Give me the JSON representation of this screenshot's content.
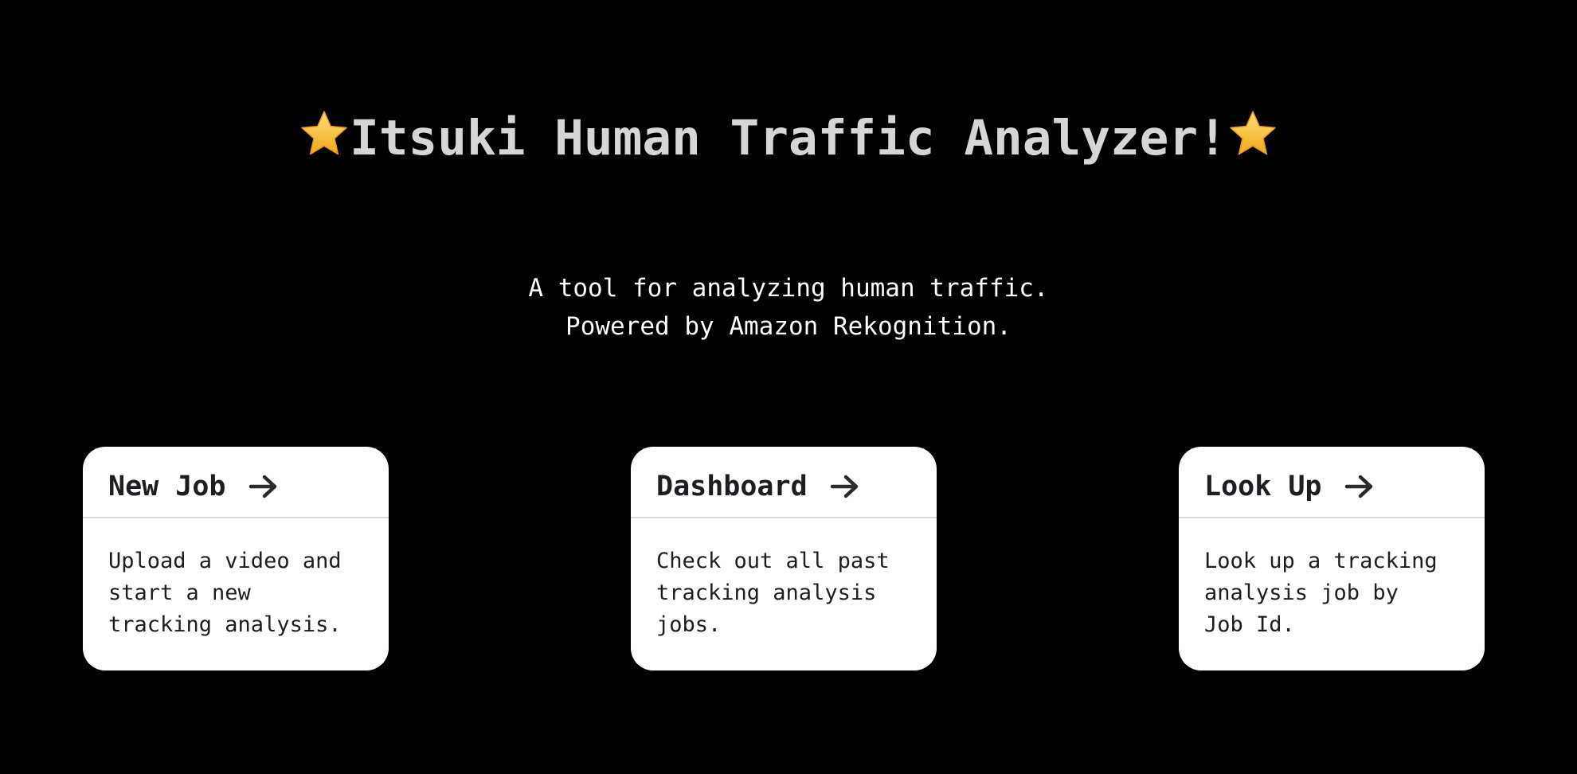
{
  "header": {
    "title": "Itsuki Human Traffic Analyzer!",
    "star_icon": "star-icon",
    "title_color": "#d6d6d6"
  },
  "intro": {
    "line1": "A tool for analyzing human traffic.",
    "line2": "Powered by Amazon Rekognition."
  },
  "cards": [
    {
      "title": "New Job",
      "description": "Upload a video and\nstart a new\ntracking analysis.",
      "icon": "arrow-right-icon"
    },
    {
      "title": "Dashboard",
      "description": "Check out all past\ntracking analysis\njobs.",
      "icon": "arrow-right-icon"
    },
    {
      "title": "Look Up",
      "description": "Look up a tracking\nanalysis job by\nJob Id.",
      "icon": "arrow-right-icon"
    }
  ],
  "colors": {
    "background": "#000000",
    "card_background": "#ffffff",
    "text_dark": "#1c1e21",
    "star": "#f7c531"
  }
}
